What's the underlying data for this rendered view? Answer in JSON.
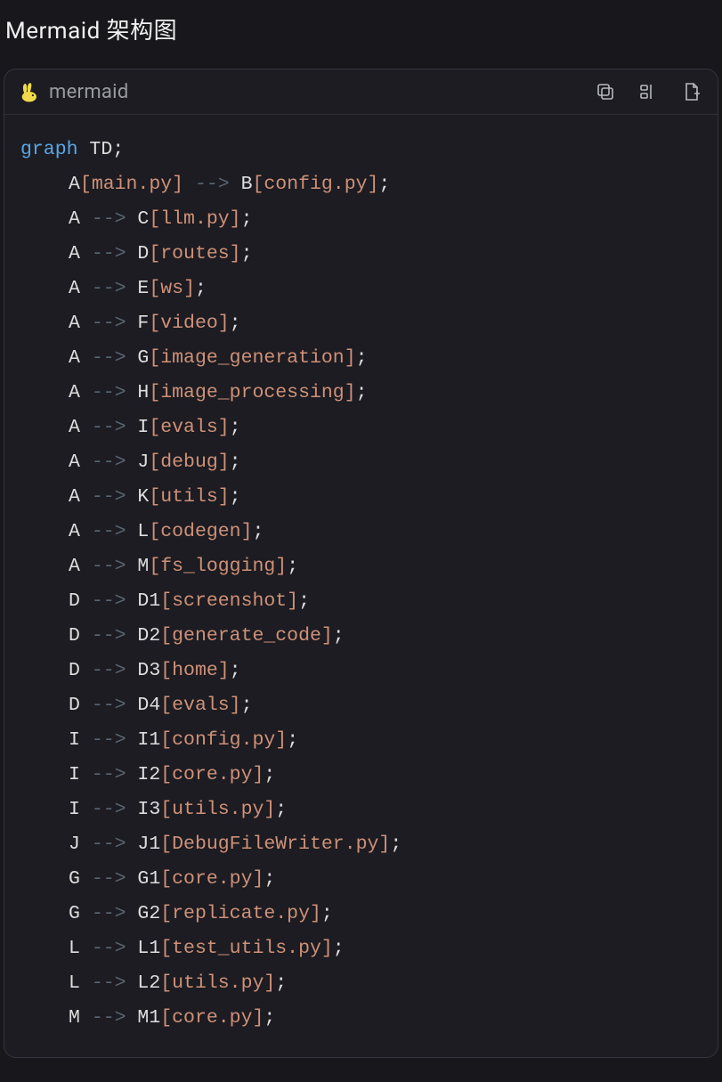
{
  "page_title": "Mermaid 架构图",
  "header": {
    "language_label": "mermaid"
  },
  "code": {
    "graph_keyword": "graph",
    "graph_type": "TD;",
    "lines": [
      {
        "indent": 1,
        "tokens": [
          {
            "t": "plain",
            "v": "A"
          },
          {
            "t": "br",
            "v": "["
          },
          {
            "t": "str",
            "v": "main.py"
          },
          {
            "t": "br",
            "v": "]"
          },
          {
            "t": "space",
            "v": " "
          },
          {
            "t": "arrow",
            "v": "-->"
          },
          {
            "t": "space",
            "v": " "
          },
          {
            "t": "plain",
            "v": "B"
          },
          {
            "t": "br",
            "v": "["
          },
          {
            "t": "str",
            "v": "config.py"
          },
          {
            "t": "br",
            "v": "]"
          },
          {
            "t": "plain",
            "v": ";"
          }
        ]
      },
      {
        "indent": 1,
        "tokens": [
          {
            "t": "plain",
            "v": "A "
          },
          {
            "t": "arrow",
            "v": "-->"
          },
          {
            "t": "plain",
            "v": " C"
          },
          {
            "t": "br",
            "v": "["
          },
          {
            "t": "str",
            "v": "llm.py"
          },
          {
            "t": "br",
            "v": "]"
          },
          {
            "t": "plain",
            "v": ";"
          }
        ]
      },
      {
        "indent": 1,
        "tokens": [
          {
            "t": "plain",
            "v": "A "
          },
          {
            "t": "arrow",
            "v": "-->"
          },
          {
            "t": "plain",
            "v": " D"
          },
          {
            "t": "br",
            "v": "["
          },
          {
            "t": "str",
            "v": "routes"
          },
          {
            "t": "br",
            "v": "]"
          },
          {
            "t": "plain",
            "v": ";"
          }
        ]
      },
      {
        "indent": 1,
        "tokens": [
          {
            "t": "plain",
            "v": "A "
          },
          {
            "t": "arrow",
            "v": "-->"
          },
          {
            "t": "plain",
            "v": " E"
          },
          {
            "t": "br",
            "v": "["
          },
          {
            "t": "str",
            "v": "ws"
          },
          {
            "t": "br",
            "v": "]"
          },
          {
            "t": "plain",
            "v": ";"
          }
        ]
      },
      {
        "indent": 1,
        "tokens": [
          {
            "t": "plain",
            "v": "A "
          },
          {
            "t": "arrow",
            "v": "-->"
          },
          {
            "t": "plain",
            "v": " F"
          },
          {
            "t": "br",
            "v": "["
          },
          {
            "t": "str",
            "v": "video"
          },
          {
            "t": "br",
            "v": "]"
          },
          {
            "t": "plain",
            "v": ";"
          }
        ]
      },
      {
        "indent": 1,
        "tokens": [
          {
            "t": "plain",
            "v": "A "
          },
          {
            "t": "arrow",
            "v": "-->"
          },
          {
            "t": "plain",
            "v": " G"
          },
          {
            "t": "br",
            "v": "["
          },
          {
            "t": "str",
            "v": "image_generation"
          },
          {
            "t": "br",
            "v": "]"
          },
          {
            "t": "plain",
            "v": ";"
          }
        ]
      },
      {
        "indent": 1,
        "tokens": [
          {
            "t": "plain",
            "v": "A "
          },
          {
            "t": "arrow",
            "v": "-->"
          },
          {
            "t": "plain",
            "v": " H"
          },
          {
            "t": "br",
            "v": "["
          },
          {
            "t": "str",
            "v": "image_processing"
          },
          {
            "t": "br",
            "v": "]"
          },
          {
            "t": "plain",
            "v": ";"
          }
        ]
      },
      {
        "indent": 1,
        "tokens": [
          {
            "t": "plain",
            "v": "A "
          },
          {
            "t": "arrow",
            "v": "-->"
          },
          {
            "t": "plain",
            "v": " I"
          },
          {
            "t": "br",
            "v": "["
          },
          {
            "t": "str",
            "v": "evals"
          },
          {
            "t": "br",
            "v": "]"
          },
          {
            "t": "plain",
            "v": ";"
          }
        ]
      },
      {
        "indent": 1,
        "tokens": [
          {
            "t": "plain",
            "v": "A "
          },
          {
            "t": "arrow",
            "v": "-->"
          },
          {
            "t": "plain",
            "v": " J"
          },
          {
            "t": "br",
            "v": "["
          },
          {
            "t": "str",
            "v": "debug"
          },
          {
            "t": "br",
            "v": "]"
          },
          {
            "t": "plain",
            "v": ";"
          }
        ]
      },
      {
        "indent": 1,
        "tokens": [
          {
            "t": "plain",
            "v": "A "
          },
          {
            "t": "arrow",
            "v": "-->"
          },
          {
            "t": "plain",
            "v": " K"
          },
          {
            "t": "br",
            "v": "["
          },
          {
            "t": "str",
            "v": "utils"
          },
          {
            "t": "br",
            "v": "]"
          },
          {
            "t": "plain",
            "v": ";"
          }
        ]
      },
      {
        "indent": 1,
        "tokens": [
          {
            "t": "plain",
            "v": "A "
          },
          {
            "t": "arrow",
            "v": "-->"
          },
          {
            "t": "plain",
            "v": " L"
          },
          {
            "t": "br",
            "v": "["
          },
          {
            "t": "str",
            "v": "codegen"
          },
          {
            "t": "br",
            "v": "]"
          },
          {
            "t": "plain",
            "v": ";"
          }
        ]
      },
      {
        "indent": 1,
        "tokens": [
          {
            "t": "plain",
            "v": "A "
          },
          {
            "t": "arrow",
            "v": "-->"
          },
          {
            "t": "plain",
            "v": " M"
          },
          {
            "t": "br",
            "v": "["
          },
          {
            "t": "str",
            "v": "fs_logging"
          },
          {
            "t": "br",
            "v": "]"
          },
          {
            "t": "plain",
            "v": ";"
          }
        ]
      },
      {
        "indent": 1,
        "tokens": [
          {
            "t": "plain",
            "v": "D "
          },
          {
            "t": "arrow",
            "v": "-->"
          },
          {
            "t": "plain",
            "v": " D1"
          },
          {
            "t": "br",
            "v": "["
          },
          {
            "t": "str",
            "v": "screenshot"
          },
          {
            "t": "br",
            "v": "]"
          },
          {
            "t": "plain",
            "v": ";"
          }
        ]
      },
      {
        "indent": 1,
        "tokens": [
          {
            "t": "plain",
            "v": "D "
          },
          {
            "t": "arrow",
            "v": "-->"
          },
          {
            "t": "plain",
            "v": " D2"
          },
          {
            "t": "br",
            "v": "["
          },
          {
            "t": "str",
            "v": "generate_code"
          },
          {
            "t": "br",
            "v": "]"
          },
          {
            "t": "plain",
            "v": ";"
          }
        ]
      },
      {
        "indent": 1,
        "tokens": [
          {
            "t": "plain",
            "v": "D "
          },
          {
            "t": "arrow",
            "v": "-->"
          },
          {
            "t": "plain",
            "v": " D3"
          },
          {
            "t": "br",
            "v": "["
          },
          {
            "t": "str",
            "v": "home"
          },
          {
            "t": "br",
            "v": "]"
          },
          {
            "t": "plain",
            "v": ";"
          }
        ]
      },
      {
        "indent": 1,
        "tokens": [
          {
            "t": "plain",
            "v": "D "
          },
          {
            "t": "arrow",
            "v": "-->"
          },
          {
            "t": "plain",
            "v": " D4"
          },
          {
            "t": "br",
            "v": "["
          },
          {
            "t": "str",
            "v": "evals"
          },
          {
            "t": "br",
            "v": "]"
          },
          {
            "t": "plain",
            "v": ";"
          }
        ]
      },
      {
        "indent": 1,
        "tokens": [
          {
            "t": "plain",
            "v": "I "
          },
          {
            "t": "arrow",
            "v": "-->"
          },
          {
            "t": "plain",
            "v": " I1"
          },
          {
            "t": "br",
            "v": "["
          },
          {
            "t": "str",
            "v": "config.py"
          },
          {
            "t": "br",
            "v": "]"
          },
          {
            "t": "plain",
            "v": ";"
          }
        ]
      },
      {
        "indent": 1,
        "tokens": [
          {
            "t": "plain",
            "v": "I "
          },
          {
            "t": "arrow",
            "v": "-->"
          },
          {
            "t": "plain",
            "v": " I2"
          },
          {
            "t": "br",
            "v": "["
          },
          {
            "t": "str",
            "v": "core.py"
          },
          {
            "t": "br",
            "v": "]"
          },
          {
            "t": "plain",
            "v": ";"
          }
        ]
      },
      {
        "indent": 1,
        "tokens": [
          {
            "t": "plain",
            "v": "I "
          },
          {
            "t": "arrow",
            "v": "-->"
          },
          {
            "t": "plain",
            "v": " I3"
          },
          {
            "t": "br",
            "v": "["
          },
          {
            "t": "str",
            "v": "utils.py"
          },
          {
            "t": "br",
            "v": "]"
          },
          {
            "t": "plain",
            "v": ";"
          }
        ]
      },
      {
        "indent": 1,
        "tokens": [
          {
            "t": "plain",
            "v": "J "
          },
          {
            "t": "arrow",
            "v": "-->"
          },
          {
            "t": "plain",
            "v": " J1"
          },
          {
            "t": "br",
            "v": "["
          },
          {
            "t": "str",
            "v": "DebugFileWriter.py"
          },
          {
            "t": "br",
            "v": "]"
          },
          {
            "t": "plain",
            "v": ";"
          }
        ]
      },
      {
        "indent": 1,
        "tokens": [
          {
            "t": "plain",
            "v": "G "
          },
          {
            "t": "arrow",
            "v": "-->"
          },
          {
            "t": "plain",
            "v": " G1"
          },
          {
            "t": "br",
            "v": "["
          },
          {
            "t": "str",
            "v": "core.py"
          },
          {
            "t": "br",
            "v": "]"
          },
          {
            "t": "plain",
            "v": ";"
          }
        ]
      },
      {
        "indent": 1,
        "tokens": [
          {
            "t": "plain",
            "v": "G "
          },
          {
            "t": "arrow",
            "v": "-->"
          },
          {
            "t": "plain",
            "v": " G2"
          },
          {
            "t": "br",
            "v": "["
          },
          {
            "t": "str",
            "v": "replicate.py"
          },
          {
            "t": "br",
            "v": "]"
          },
          {
            "t": "plain",
            "v": ";"
          }
        ]
      },
      {
        "indent": 1,
        "tokens": [
          {
            "t": "plain",
            "v": "L "
          },
          {
            "t": "arrow",
            "v": "-->"
          },
          {
            "t": "plain",
            "v": " L1"
          },
          {
            "t": "br",
            "v": "["
          },
          {
            "t": "str",
            "v": "test_utils.py"
          },
          {
            "t": "br",
            "v": "]"
          },
          {
            "t": "plain",
            "v": ";"
          }
        ]
      },
      {
        "indent": 1,
        "tokens": [
          {
            "t": "plain",
            "v": "L "
          },
          {
            "t": "arrow",
            "v": "-->"
          },
          {
            "t": "plain",
            "v": " L2"
          },
          {
            "t": "br",
            "v": "["
          },
          {
            "t": "str",
            "v": "utils.py"
          },
          {
            "t": "br",
            "v": "]"
          },
          {
            "t": "plain",
            "v": ";"
          }
        ]
      },
      {
        "indent": 1,
        "tokens": [
          {
            "t": "plain",
            "v": "M "
          },
          {
            "t": "arrow",
            "v": "-->"
          },
          {
            "t": "plain",
            "v": " M1"
          },
          {
            "t": "br",
            "v": "["
          },
          {
            "t": "str",
            "v": "core.py"
          },
          {
            "t": "br",
            "v": "]"
          },
          {
            "t": "plain",
            "v": ";"
          }
        ]
      }
    ]
  }
}
